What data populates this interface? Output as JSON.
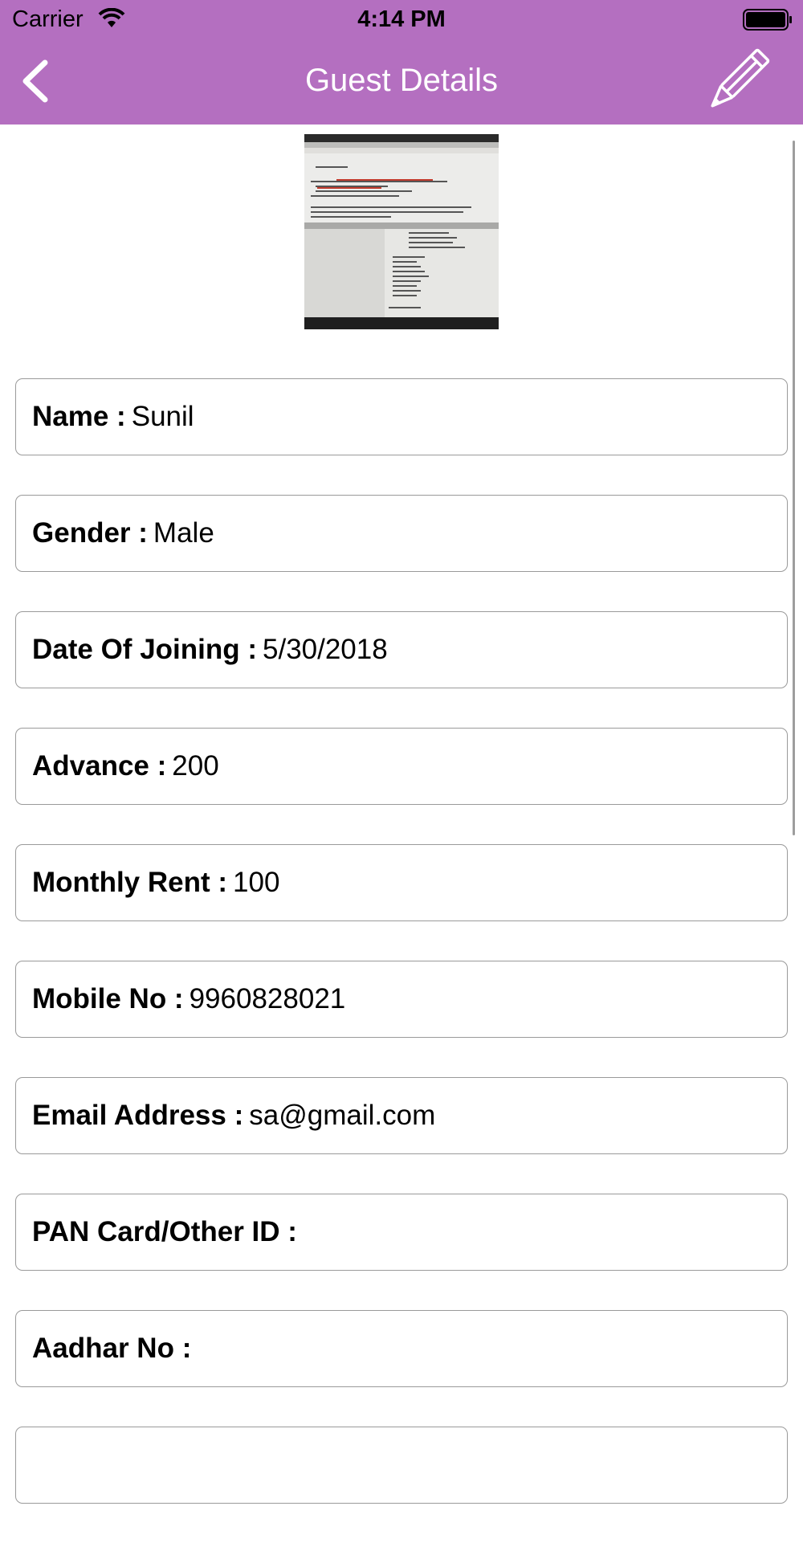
{
  "status_bar": {
    "carrier": "Carrier",
    "time": "4:14 PM"
  },
  "nav": {
    "title": "Guest Details",
    "back_icon": "chevron-left-icon",
    "edit_icon": "pencil-icon"
  },
  "colors": {
    "accent": "#b46fc0",
    "field_border": "#9a9a9a"
  },
  "fields": [
    {
      "label": "Name :",
      "value": "Sunil"
    },
    {
      "label": "Gender :",
      "value": "Male"
    },
    {
      "label": "Date Of Joining :",
      "value": "5/30/2018"
    },
    {
      "label": "Advance :",
      "value": "200"
    },
    {
      "label": "Monthly Rent :",
      "value": "100"
    },
    {
      "label": "Mobile No :",
      "value": "9960828021"
    },
    {
      "label": "Email Address :",
      "value": "sa@gmail.com"
    },
    {
      "label": "PAN Card/Other ID :",
      "value": ""
    },
    {
      "label": "Aadhar No :",
      "value": ""
    },
    {
      "label": "",
      "value": ""
    }
  ]
}
